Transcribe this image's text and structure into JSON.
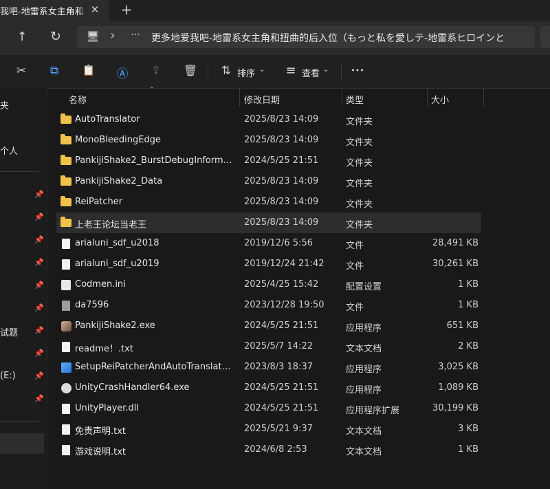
{
  "tab": {
    "title": "我吧-地雷系女主角和扭",
    "close": "✕",
    "new_tab": "+"
  },
  "nav": {
    "up": "↑",
    "refresh": "↻",
    "pc": "🖥",
    "chevron": "›",
    "more": "···",
    "path": "更多地爱我吧-地雷系女主角和扭曲的后入位（もっと私を愛しテ-地雷系ヒロインと"
  },
  "command_bar": {
    "cut": "✂",
    "copy": "⧉",
    "paste": "📋",
    "rename": "Ⓐ",
    "share": "⇪",
    "delete": "🗑",
    "sort_icon": "⇅",
    "sort_label": "排序",
    "view_icon": "≡",
    "view_label": "查看",
    "caret": "⌄",
    "more": "•••"
  },
  "sidebar": {
    "labels": [
      "夹",
      "个人",
      "试题",
      "(E:)"
    ],
    "pin": "📌"
  },
  "columns": {
    "name": "名称",
    "date": "修改日期",
    "type": "类型",
    "size": "大小",
    "sort_arrow": "⌃"
  },
  "files": [
    {
      "name": "AutoTranslator",
      "date": "2025/8/23 14:09",
      "type": "文件夹",
      "size": "",
      "icon": "folder-icon"
    },
    {
      "name": "MonoBleedingEdge",
      "date": "2025/8/23 14:09",
      "type": "文件夹",
      "size": "",
      "icon": "folder-icon"
    },
    {
      "name": "PankijiShake2_BurstDebugInformatio...",
      "date": "2024/5/25 21:51",
      "type": "文件夹",
      "size": "",
      "icon": "folder-icon"
    },
    {
      "name": "PankijiShake2_Data",
      "date": "2025/8/23 14:09",
      "type": "文件夹",
      "size": "",
      "icon": "folder-icon"
    },
    {
      "name": "ReiPatcher",
      "date": "2025/8/23 14:09",
      "type": "文件夹",
      "size": "",
      "icon": "folder-icon"
    },
    {
      "name": "上老王论坛当老王",
      "date": "2025/8/23 14:09",
      "type": "文件夹",
      "size": "",
      "icon": "folder-icon",
      "selected": true
    },
    {
      "name": "arialuni_sdf_u2018",
      "date": "2019/12/6 5:56",
      "type": "文件",
      "size": "28,491 KB",
      "icon": "file-icon"
    },
    {
      "name": "arialuni_sdf_u2019",
      "date": "2019/12/24 21:42",
      "type": "文件",
      "size": "30,261 KB",
      "icon": "file-icon"
    },
    {
      "name": "Codmen.ini",
      "date": "2025/4/25 15:42",
      "type": "配置设置",
      "size": "1 KB",
      "icon": "ini-icon"
    },
    {
      "name": "da7596",
      "date": "2023/12/28 19:50",
      "type": "文件",
      "size": "1 KB",
      "icon": "file-gray-icon"
    },
    {
      "name": "PankijiShake2.exe",
      "date": "2024/5/25 21:51",
      "type": "应用程序",
      "size": "651 KB",
      "icon": "app-icon"
    },
    {
      "name": "readme！.txt",
      "date": "2025/5/7 14:22",
      "type": "文本文档",
      "size": "2 KB",
      "icon": "text-file-icon"
    },
    {
      "name": "SetupReiPatcherAndAutoTranslator.e...",
      "date": "2023/8/3 18:37",
      "type": "应用程序",
      "size": "3,025 KB",
      "icon": "setup-icon"
    },
    {
      "name": "UnityCrashHandler64.exe",
      "date": "2024/5/25 21:51",
      "type": "应用程序",
      "size": "1,089 KB",
      "icon": "unity-icon"
    },
    {
      "name": "UnityPlayer.dll",
      "date": "2024/5/25 21:51",
      "type": "应用程序扩展",
      "size": "30,199 KB",
      "icon": "dll-icon"
    },
    {
      "name": "免责声明.txt",
      "date": "2025/5/21 9:37",
      "type": "文本文档",
      "size": "3 KB",
      "icon": "text-file-icon"
    },
    {
      "name": "游戏说明.txt",
      "date": "2024/6/8 2:53",
      "type": "文本文档",
      "size": "1 KB",
      "icon": "text-file-icon"
    }
  ]
}
